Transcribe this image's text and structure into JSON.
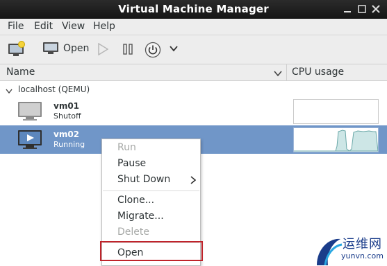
{
  "window": {
    "title": "Virtual Machine Manager"
  },
  "menu": {
    "file": "File",
    "edit": "Edit",
    "view": "View",
    "help": "Help"
  },
  "toolbar": {
    "open_label": "Open"
  },
  "columns": {
    "name": "Name",
    "cpu": "CPU usage"
  },
  "connection": {
    "label": "localhost (QEMU)"
  },
  "vms": [
    {
      "name": "vm01",
      "status": "Shutoff"
    },
    {
      "name": "vm02",
      "status": "Running"
    }
  ],
  "context_menu": {
    "run": "Run",
    "pause": "Pause",
    "shutdown": "Shut Down",
    "clone": "Clone...",
    "migrate": "Migrate...",
    "delete": "Delete",
    "open": "Open"
  },
  "watermark": {
    "cn": "运维网",
    "en": "yunvn.com"
  },
  "colors": {
    "selection": "#7096c8",
    "highlight_border": "#c0232a",
    "titlebar": "#1f1f1f"
  },
  "icons": [
    "new-vm-icon",
    "monitor-icon",
    "run-icon",
    "pause-icon",
    "power-icon",
    "chevron-down-icon",
    "close-icon",
    "minimize-icon",
    "maximize-icon"
  ]
}
